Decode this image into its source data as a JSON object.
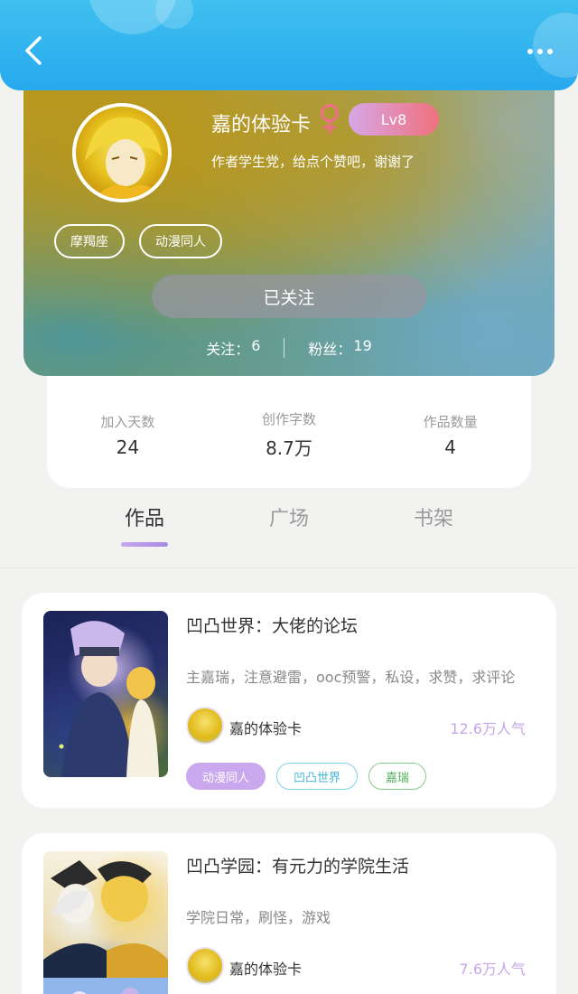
{
  "header": {
    "back_icon": "chevron-left-icon",
    "more_icon": "more-horizontal-icon"
  },
  "profile": {
    "name": "嘉的体验卡",
    "gender_icon": "female-icon",
    "level": "Lv8",
    "bio": "作者学生党，给点个赞吧，谢谢了",
    "tags": [
      "摩羯座",
      "动漫同人"
    ],
    "follow_button": "已关注",
    "following_label": "关注：",
    "following_count": "6",
    "followers_label": "粉丝：",
    "followers_count": "19"
  },
  "stats": [
    {
      "label": "加入天数",
      "value": "24"
    },
    {
      "label": "创作字数",
      "value": "8.7万"
    },
    {
      "label": "作品数量",
      "value": "4"
    }
  ],
  "tabs": [
    {
      "label": "作品",
      "active": true
    },
    {
      "label": "广场",
      "active": false
    },
    {
      "label": "书架",
      "active": false
    }
  ],
  "works": [
    {
      "title": "凹凸世界：大佬的论坛",
      "desc": "主嘉瑞，注意避雷，ooc预警，私设，求赞，求评论",
      "author": "嘉的体验卡",
      "popularity": "12.6万人气",
      "tags": [
        "动漫同人",
        "凹凸世界",
        "嘉瑞"
      ]
    },
    {
      "title": "凹凸学园：有元力的学院生活",
      "desc": "学院日常，刷怪，游戏",
      "author": "嘉的体验卡",
      "popularity": "7.6万人气",
      "tags": []
    }
  ],
  "colors": {
    "header_blue": "#27a9ee",
    "accent_purple": "#c9a8ee",
    "level_pink": "#f0707c"
  }
}
